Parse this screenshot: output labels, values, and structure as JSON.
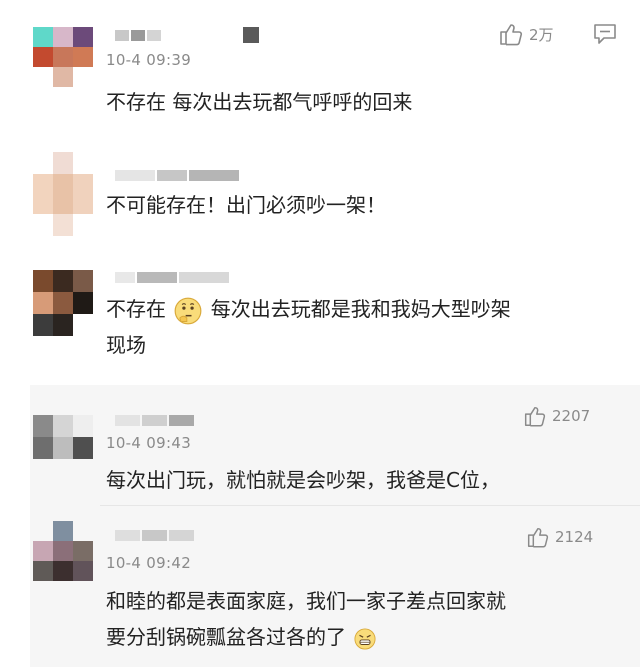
{
  "comments": [
    {
      "time": "10-4 09:39",
      "text": "不存在 每次出去玩都气呼呼的回来",
      "likes": "2万",
      "avatar_colors": [
        "#5fd8c9",
        "#d7b7c9",
        "#6c4a7a",
        "#c34a2f",
        "#c8775a",
        "#d07a55",
        "#ffffff",
        "#e0b8a5",
        "#ffffff"
      ],
      "name_colors": [
        "#c8c8c8",
        "#9a9a9a",
        "#d4d4d4",
        "#5a5a5a"
      ]
    },
    {
      "text_a": "不可能存在！出门必须吵一架！",
      "avatar_colors": [
        "#ffffff",
        "#f0dcd4",
        "#ffffff",
        "#f2d4be",
        "#e8c2a7",
        "#f0d2bd",
        "#ffffff",
        "#f3e0d5",
        "#ffffff"
      ],
      "name_colors": [
        "#e5e5e5",
        "#c6c6c6",
        "#b5b5b5"
      ]
    },
    {
      "text_a": "不存在",
      "text_b": "每次出去玩都是我和我妈大型吵架",
      "text_c": "现场",
      "avatar_colors": [
        "#7a4a2d",
        "#3b2a20",
        "#7a5a48",
        "#d79b78",
        "#8b5a3f",
        "#1f1a16",
        "#3c3c3c",
        "#2a2420",
        "#ffffff"
      ],
      "name_colors": [
        "#e8e8e8",
        "#b9b9b9",
        "#d8d8d8"
      ]
    },
    {
      "time": "10-4 09:43",
      "text": "每次出门玩，就怕就是会吵架，我爸是C位，",
      "likes": "2207",
      "avatar_colors": [
        "#8a8a8a",
        "#d5d5d5",
        "#eeeeee",
        "#6e6e6e",
        "#bdbdbd",
        "#4f4f4f"
      ],
      "name_colors": [
        "#e3e3e3",
        "#cfcfcf",
        "#a9a9a9"
      ]
    },
    {
      "time": "10-4 09:42",
      "text_a": "和睦的都是表面家庭，我们一家子差点回家就",
      "text_b": "要分刮锅碗瓢盆各过各的了",
      "likes": "2124",
      "avatar_colors": [
        "#f6f6f6",
        "#7f8fa0",
        "#f6f6f6",
        "#c7a6b3",
        "#8b6f79",
        "#7a6d66",
        "#5f5a57",
        "#3c2f2f",
        "#61535a"
      ],
      "name_colors": [
        "#dedede",
        "#c8c8c8",
        "#d5d5d5"
      ]
    }
  ],
  "icons": {
    "like": "thumbs-up-icon",
    "reply": "comment-icon",
    "emoji_thinking": "thinking-emoji",
    "emoji_grin": "grimace-emoji"
  }
}
